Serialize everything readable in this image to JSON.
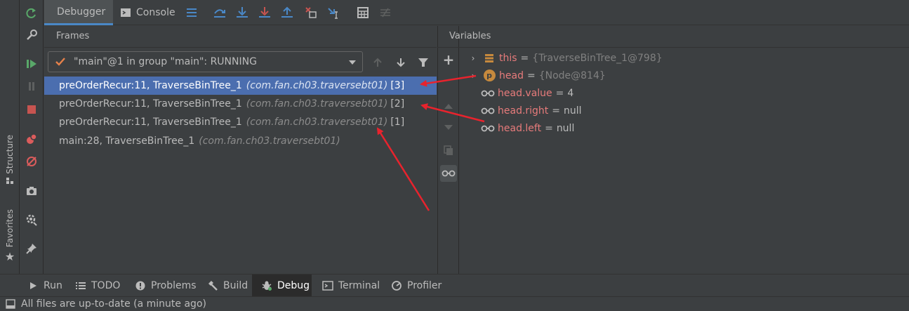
{
  "side_tabs": {
    "structure": "Structure",
    "favorites": "Favorites"
  },
  "top_tabs": {
    "debugger": "Debugger",
    "console": "Console"
  },
  "frames": {
    "title": "Frames",
    "thread": "\"main\"@1 in group \"main\": RUNNING",
    "rows": [
      {
        "method": "preOrderRecur:11, TraverseBinTree_1",
        "pkg": "(com.fan.ch03.traversebt01)",
        "depth": "[3]"
      },
      {
        "method": "preOrderRecur:11, TraverseBinTree_1",
        "pkg": "(com.fan.ch03.traversebt01)",
        "depth": "[2]"
      },
      {
        "method": "preOrderRecur:11, TraverseBinTree_1",
        "pkg": "(com.fan.ch03.traversebt01)",
        "depth": "[1]"
      },
      {
        "method": "main:28, TraverseBinTree_1",
        "pkg": "(com.fan.ch03.traversebt01)",
        "depth": ""
      }
    ]
  },
  "variables": {
    "title": "Variables",
    "rows": [
      {
        "name": "this",
        "eq": "=",
        "value": "{TraverseBinTree_1@798}",
        "icon": "field-icon",
        "expandable": "›"
      },
      {
        "name": "head",
        "eq": "=",
        "value": "{Node@814}",
        "icon": "p-icon",
        "icon_letter": "p",
        "expandable": "›"
      },
      {
        "name": "head.value",
        "eq": "=",
        "value": "4",
        "icon": "watch-glasses-icon"
      },
      {
        "name": "head.right",
        "eq": "=",
        "value": "null",
        "icon": "watch-glasses-icon"
      },
      {
        "name": "head.left",
        "eq": "=",
        "value": "null",
        "icon": "watch-glasses-icon"
      }
    ]
  },
  "bottom_tabs": {
    "run": "Run",
    "todo": "TODO",
    "problems": "Problems",
    "build": "Build",
    "debug": "Debug",
    "terminal": "Terminal",
    "profiler": "Profiler"
  },
  "status": {
    "text": "All files are up-to-date (a minute ago)"
  },
  "colors": {
    "selection": "#4b6eaf",
    "variable_name": "#e77b7b",
    "annotation_arrow": "#e8232d",
    "tab_underline": "#4a88c7"
  }
}
